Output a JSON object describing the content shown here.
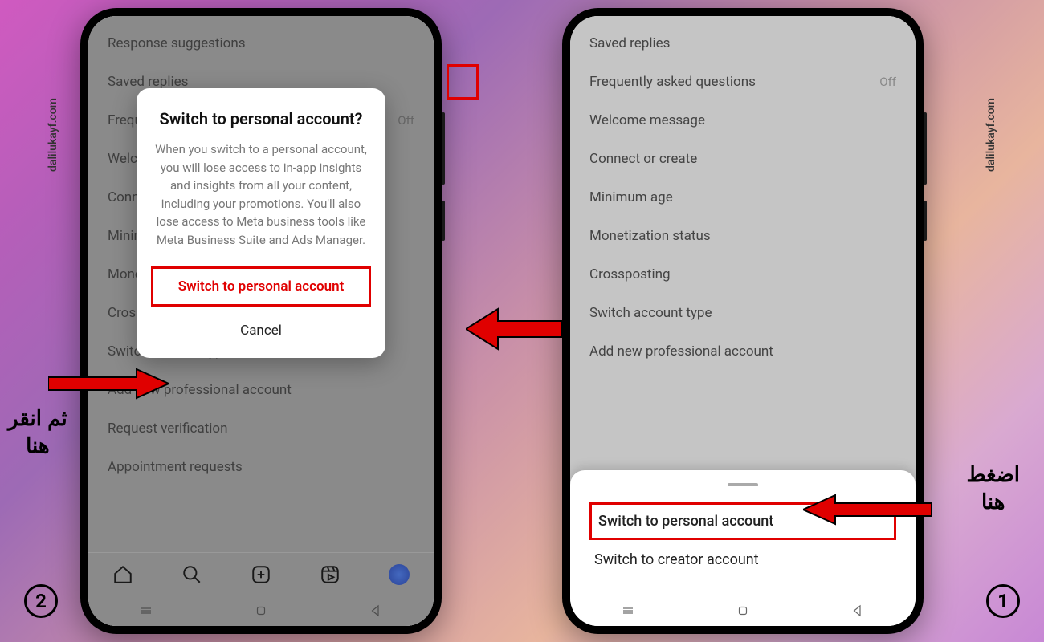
{
  "watermark": "dalilukayf.com",
  "badges": {
    "one": "1",
    "two": "2"
  },
  "annotations": {
    "right": "اضغط\nهنا",
    "left": "ثم انقر\nهنا"
  },
  "phone_right": {
    "settings": [
      {
        "label": "Saved replies",
        "value": ""
      },
      {
        "label": "Frequently asked questions",
        "value": "Off"
      },
      {
        "label": "Welcome message",
        "value": ""
      },
      {
        "label": "Connect or create",
        "value": ""
      },
      {
        "label": "Minimum age",
        "value": ""
      },
      {
        "label": "Monetization status",
        "value": ""
      },
      {
        "label": "Crossposting",
        "value": ""
      },
      {
        "label": "Switch account type",
        "value": ""
      },
      {
        "label": "Add new professional account",
        "value": ""
      }
    ],
    "sheet": {
      "opt1": "Switch to personal account",
      "opt2": "Switch to creator account"
    }
  },
  "phone_left": {
    "settings": [
      {
        "label": "Response suggestions",
        "value": ""
      },
      {
        "label": "Saved replies",
        "value": ""
      },
      {
        "label": "Frequently asked questions",
        "value": "Off"
      },
      {
        "label": "Welcome message",
        "value": ""
      },
      {
        "label": "Connect or create",
        "value": ""
      },
      {
        "label": "Minimum age",
        "value": ""
      },
      {
        "label": "Monetization status",
        "value": ""
      },
      {
        "label": "Crossposting",
        "value": ""
      },
      {
        "label": "Switch account type",
        "value": ""
      },
      {
        "label": "Add new professional account",
        "value": ""
      },
      {
        "label": "Request verification",
        "value": ""
      },
      {
        "label": "Appointment requests",
        "value": ""
      }
    ],
    "dialog": {
      "title": "Switch to personal account?",
      "body": "When you switch to a personal account, you will lose access to in-app insights and insights from all your content, including your promotions. You'll also lose access to Meta business tools like Meta Business Suite and Ads Manager.",
      "confirm": "Switch to personal account",
      "cancel": "Cancel"
    }
  },
  "colors": {
    "highlight": "#e00000"
  }
}
